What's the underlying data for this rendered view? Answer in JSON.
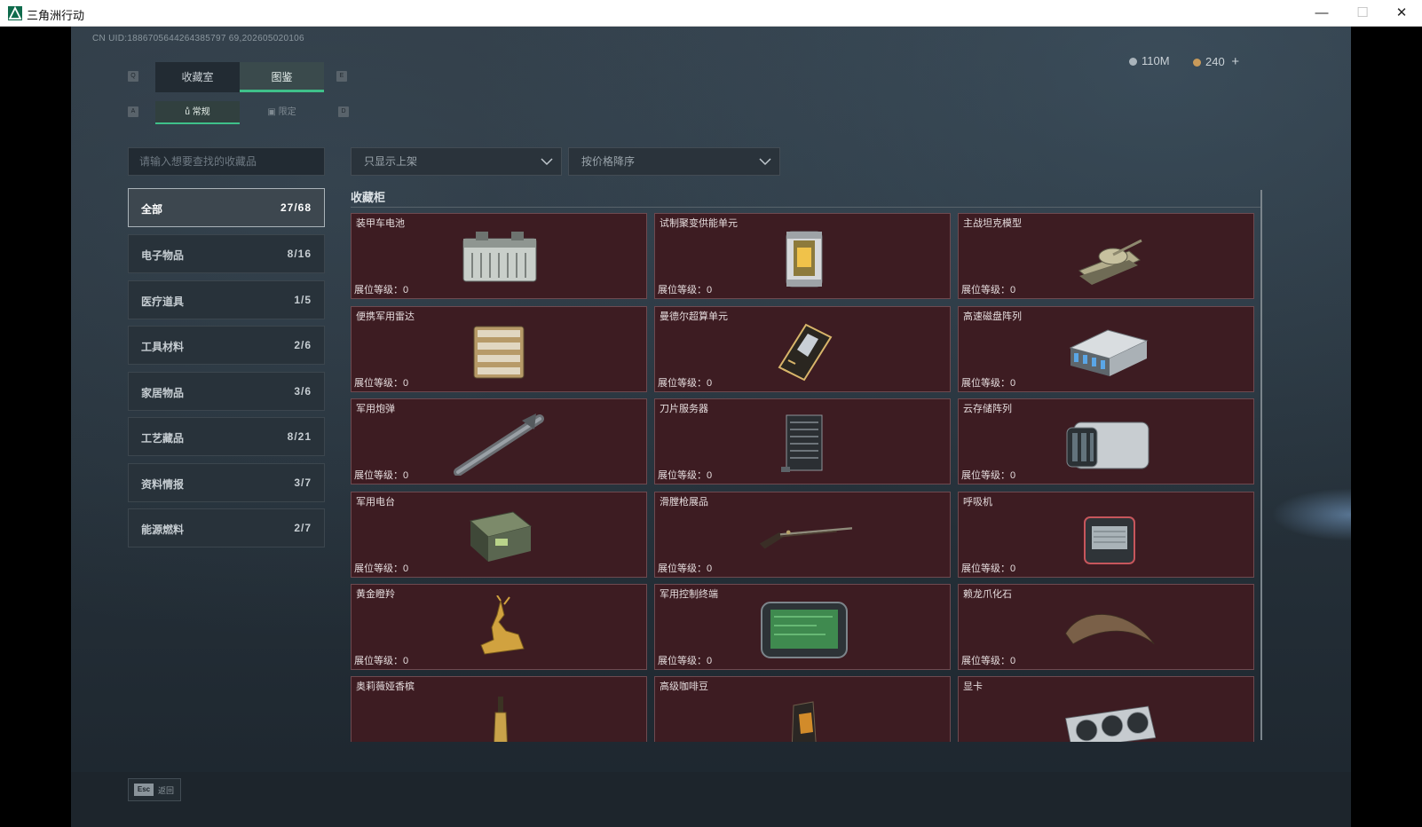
{
  "window": {
    "title": "三角洲行动",
    "minimize": "—",
    "maximize": "☐",
    "close": "✕"
  },
  "header": {
    "uid": "CN UID:1886705644264385797 69,202605020106",
    "money": "110M",
    "coins": "240",
    "add": "+"
  },
  "keys": {
    "q": "Q",
    "e": "E",
    "a": "A",
    "d": "D"
  },
  "tabs": [
    {
      "label": "收藏室"
    },
    {
      "label": "图鉴"
    }
  ],
  "subtabs": [
    {
      "label": "常规"
    },
    {
      "label": "限定"
    }
  ],
  "search": {
    "placeholder": "请输入想要查找的收藏品"
  },
  "filters": [
    {
      "label": "只显示上架"
    },
    {
      "label": "按价格降序"
    }
  ],
  "categories": [
    {
      "label": "全部",
      "count": "27/68"
    },
    {
      "label": "电子物品",
      "count": "8/16"
    },
    {
      "label": "医疗道具",
      "count": "1/5"
    },
    {
      "label": "工具材料",
      "count": "2/6"
    },
    {
      "label": "家居物品",
      "count": "3/6"
    },
    {
      "label": "工艺藏品",
      "count": "8/21"
    },
    {
      "label": "资料情报",
      "count": "3/7"
    },
    {
      "label": "能源燃料",
      "count": "2/7"
    }
  ],
  "section": {
    "title": "收藏柜"
  },
  "level_label": "展位等级：0",
  "items": [
    {
      "name": "装甲车电池",
      "icon": "battery-icon"
    },
    {
      "name": "试制聚变供能单元",
      "icon": "fusion-cell-icon"
    },
    {
      "name": "主战坦克模型",
      "icon": "tank-model-icon"
    },
    {
      "name": "便携军用雷达",
      "icon": "radar-icon"
    },
    {
      "name": "曼德尔超算单元",
      "icon": "supercomputer-icon"
    },
    {
      "name": "高速磁盘阵列",
      "icon": "disk-array-icon"
    },
    {
      "name": "军用炮弹",
      "icon": "missile-icon"
    },
    {
      "name": "刀片服务器",
      "icon": "blade-server-icon"
    },
    {
      "name": "云存储阵列",
      "icon": "cloud-storage-icon"
    },
    {
      "name": "军用电台",
      "icon": "radio-icon"
    },
    {
      "name": "滑膛枪展品",
      "icon": "musket-icon"
    },
    {
      "name": "呼吸机",
      "icon": "ventilator-icon"
    },
    {
      "name": "黄金瞪羚",
      "icon": "golden-gazelle-icon"
    },
    {
      "name": "军用控制终端",
      "icon": "control-terminal-icon"
    },
    {
      "name": "赖龙爪化石",
      "icon": "claw-fossil-icon"
    },
    {
      "name": "奥莉薇娅香槟",
      "icon": "champagne-icon"
    },
    {
      "name": "高级咖啡豆",
      "icon": "coffee-bag-icon"
    },
    {
      "name": "显卡",
      "icon": "gpu-icon"
    }
  ],
  "footer": {
    "key": "Esc",
    "label": "返回"
  }
}
